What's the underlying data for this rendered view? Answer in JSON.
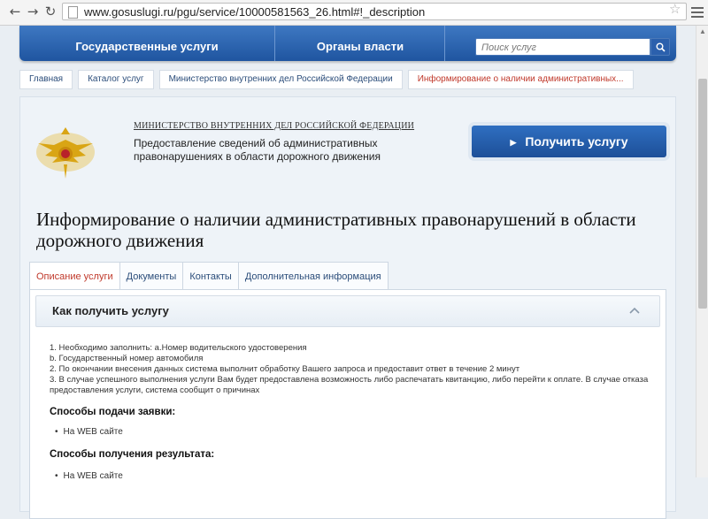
{
  "browser": {
    "back_icon": "arrow-left-icon",
    "forward_icon": "arrow-right-icon",
    "reload_icon": "reload-icon",
    "url": "www.gosuslugi.ru/pgu/service/10000581563_26.html#!_description"
  },
  "top_nav": {
    "tab1": "Государственные услуги",
    "tab2": "Органы власти",
    "search_placeholder": "Поиск услуг"
  },
  "breadcrumbs": [
    "Главная",
    "Каталог услуг",
    "Министерство внутренних дел Российской Федерации",
    "Информирование о наличии административных..."
  ],
  "card": {
    "ministry": "МИНИСТЕРСТВО ВНУТРЕННИХ ДЕЛ РОССИЙСКОЙ ФЕДЕРАЦИИ",
    "service_desc": "Предоставление сведений об административных правонарушениях в области дорожного движения",
    "get_service": "Получить услугу",
    "title": "Информирование о наличии административных правонарушений в области дорожного движения"
  },
  "tabs": [
    "Описание услуги",
    "Документы",
    "Контакты",
    "Дополнительная информация"
  ],
  "panel": {
    "section_title": "Как получить услугу",
    "steps": [
      "1. Необходимо заполнить: а.Номер водительского удостоверения",
      "b. Государственный номер автомобиля",
      "2. По окончании внесения данных система выполнит обработку Вашего запроса и предоставит ответ в течение 2 минут",
      "3. В случае успешного выполнения услуги Вам будет предоставлена возможность либо распечатать квитанцию, либо перейти к оплате. В случае отказа предоставления услуги, система сообщит о причинах"
    ],
    "submit_title": "Способы подачи заявки:",
    "submit_item": "На WEB сайте",
    "result_title": "Способы получения результата:",
    "result_item": "На WEB сайте"
  }
}
